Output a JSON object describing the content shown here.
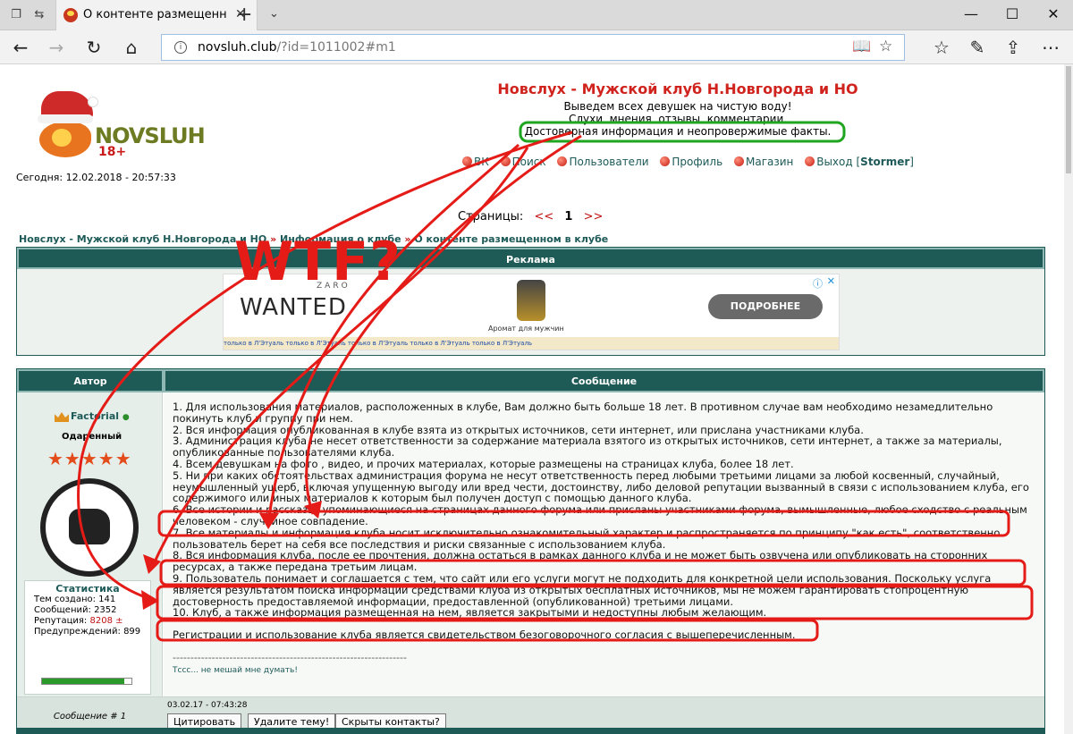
{
  "browser": {
    "tab_title": "О контенте размещенн",
    "url_host": "novsluh.club",
    "url_path": "/?id=1011002#m1"
  },
  "site": {
    "logo_text": "NOVSLUH",
    "logo_18": "18+",
    "title": "Новслух - Мужской клуб Н.Новгорода и НО",
    "tagline1": "Выведем всех девушек на чистую воду!",
    "tagline2": "Слухи, мнения, отзывы, комментарии.",
    "tagline3": "Достоверная информация и неопровержимые факты.",
    "today": "Сегодня: 12.02.2018 - 20:57:33",
    "menu": [
      "ВК",
      "Поиск",
      "Пользователи",
      "Профиль",
      "Магазин",
      "Выход"
    ],
    "user": "Stormer"
  },
  "pages": {
    "label": "Страницы:",
    "prev": "<<",
    "current": "1",
    "next": ">>"
  },
  "breadcrumb": [
    "Новслух - Мужской клуб Н.Новгорода и НО",
    "Информация о клубе",
    "О контенте размещенном в клубе"
  ],
  "ad": {
    "header": "Реклама",
    "brand_small": "ZARO",
    "brand": "WANTED",
    "product": "Аромат для мужчин",
    "button": "ПОДРОБНЕЕ",
    "strip": "только в Л'Этуаль    только в Л'Этуаль    только в Л'Этуаль    только в Л'Этуаль    только в Л'Этуаль"
  },
  "post": {
    "col_author": "Автор",
    "col_message": "Сообщение",
    "author": {
      "name": "Factorial",
      "online": "●",
      "rank": "Одаренный",
      "stars": "★★★★★",
      "stats_title": "Статистика",
      "stats": [
        {
          "label": "Тем создано:",
          "value": "141"
        },
        {
          "label": "Сообщений:",
          "value": "2352"
        },
        {
          "label": "Репутация:",
          "value": "8208 ±"
        },
        {
          "label": "Предупреждений:",
          "value": "899"
        }
      ],
      "stat_bar_fill": 0.92
    },
    "lines": [
      "1. Для использования материалов, расположенных в клубе, Вам должно быть больше 18 лет. В противном случае вам необходимо незамедлительно покинуть клуб и группу при нем.",
      "2. Вся информация опубликованная в клубе взята из открытых источников, сети интернет, или прислана участниками клуба.",
      "3. Администрация клуба не несет ответственности за содержание материала взятого из открытых источников, сети интернет, а также за материалы, опубликованные пользователями клуба.",
      "4. Всем девушкам на фото , видео, и прочих материалах, которые размещены на страницах клуба, более 18 лет.",
      "5. Ни при каких обстоятельствах администрация форума не несут ответственность перед любыми третьими лицами за любой косвенный, случайный, неумышленный ущерб, включая упущенную выгоду или вред чести, достоинству, либо деловой репутации вызванный в связи с использованием клуба, его содержимого или иных материалов к которым был получен доступ с помощью данного клуба.",
      "6. Все истории и рассказы, упоминающиеся на страницах данного форума или присланы участниками форума, вымышленные, любое сходство с реальным человеком - случайное совпадение.",
      "7. Все материалы и информация клуба носит исключительно ознакомительный характер и распространяется по принципу \"как есть\", соответственно пользователь берет на себя все последствия и риски связанные с использованием клуба.",
      "8. Вся информация клуба, после ее прочтения, должна остаться в рамках данного клуба и не может быть озвучена или опубликовать на сторонних ресурсах, а также передана третьим лицам.",
      "9. Пользователь понимает и соглашается с тем, что сайт или его услуги могут не подходить для конкретной цели использования. Поскольку услуга является результатом поиска информации средствами клуба из открытых бесплатных источников, мы не можем гарантировать стопроцентную достоверность предоставляемой информации, предоставленной (опубликованной) третьими лицами.",
      "10. Клуб, а также информация размещенная на нем, является закрытыми и недоступны любым желающим."
    ],
    "closing": "Регистрации и использование клуба является свидетельством безоговорочного согласия с вышеперечисленным.",
    "sig_rule": "------------------------------------------------------------------",
    "sig": "Тссс... не мешай мне думать!",
    "number": "Сообщение # 1",
    "date": "03.02.17 - 07:43:28",
    "buttons": [
      "Цитировать",
      "Удалите тему!",
      "Скрыты контакты?"
    ]
  },
  "annotation": {
    "text": "WTF?",
    "color": "#e41b17",
    "green": "#1fa51f"
  }
}
